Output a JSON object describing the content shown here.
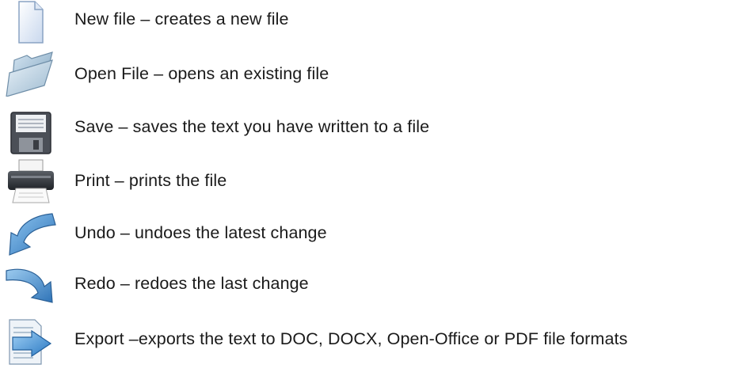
{
  "toolbar_legend": {
    "items": [
      {
        "icon": "new-file-icon",
        "text": "New file – creates a new file"
      },
      {
        "icon": "open-folder-icon",
        "text": "Open File – opens an existing file"
      },
      {
        "icon": "floppy-disk-icon",
        "text": "Save – saves the text you have written to a file"
      },
      {
        "icon": "printer-icon",
        "text": "Print – prints the file"
      },
      {
        "icon": "undo-arrow-icon",
        "text": "Undo – undoes the latest change"
      },
      {
        "icon": "redo-arrow-icon",
        "text": "Redo – redoes the last change"
      },
      {
        "icon": "export-document-icon",
        "text": "Export –exports the text to DOC, DOCX, Open-Office or PDF file formats"
      }
    ]
  }
}
